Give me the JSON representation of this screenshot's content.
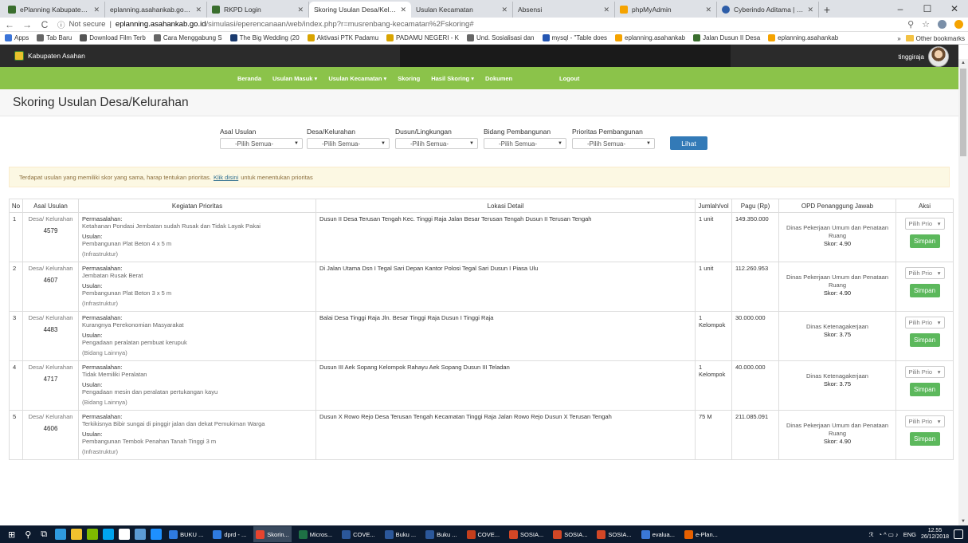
{
  "browser": {
    "tabs": [
      {
        "title": "ePlanning Kabupaten Asah",
        "icon": "app"
      },
      {
        "title": "eplanning.asahankab.go.id/",
        "icon": "page"
      },
      {
        "title": "RKPD Login",
        "icon": "app"
      },
      {
        "title": "Skoring Usulan Desa/Kelura",
        "icon": "page",
        "active": true
      },
      {
        "title": "Usulan Kecamatan",
        "icon": "page"
      },
      {
        "title": "Absensi",
        "icon": "page"
      },
      {
        "title": "phpMyAdmin",
        "icon": "pma"
      },
      {
        "title": "Cyberindo Aditama | Speed",
        "icon": "cyb"
      }
    ],
    "address": {
      "secure_label": "Not secure",
      "host": "eplanning.asahankab.go.id",
      "path": "/simulasi/eperencanaan/web/index.php?r=musrenbang-kecamatan%2Fskoring#"
    },
    "bookmarks": [
      "Apps",
      "Tab Baru",
      "Download Film Terb",
      "Cara Menggabung S",
      "The Big Wedding (20",
      "Aktivasi PTK Padamu",
      "PADAMU NEGERI - K",
      "Und. Sosialisasi dan",
      "mysql - \"Table does",
      "eplanning.asahankab",
      "Jalan Dusun II Desa",
      "eplanning.asahankab"
    ],
    "bookmarks_more": "»",
    "other_bookmarks": "Other bookmarks"
  },
  "app": {
    "brand": "Kabupaten Asahan",
    "user": "tinggiraja",
    "menu": [
      {
        "label": "Beranda",
        "dropdown": false
      },
      {
        "label": "Usulan Masuk",
        "dropdown": true
      },
      {
        "label": "Usulan Kecamatan",
        "dropdown": true
      },
      {
        "label": "Skoring",
        "dropdown": false
      },
      {
        "label": "Hasil Skoring",
        "dropdown": true
      },
      {
        "label": "Dokumen",
        "dropdown": false
      }
    ],
    "logout": "Logout",
    "page_title": "Skoring Usulan Desa/Kelurahan",
    "filters": [
      {
        "label": "Asal Usulan",
        "value": "-Pilih Semua-"
      },
      {
        "label": "Desa/Kelurahan",
        "value": "-Pilih Semua-"
      },
      {
        "label": "Dusun/Lingkungan",
        "value": "-Pilih Semua-"
      },
      {
        "label": "Bidang Pembangunan",
        "value": "-Pilih Semua-"
      },
      {
        "label": "Prioritas Pembangunan",
        "value": "-Pilih Semua-"
      }
    ],
    "lihat": "Lihat",
    "alert": {
      "before": "Terdapat usulan yang memiliki skor yang sama, harap tentukan prioritas.",
      "link": "Klik disini",
      "after": "untuk menentukan prioritas"
    },
    "table": {
      "headers": [
        "No",
        "Asal Usulan",
        "Kegiatan Prioritas",
        "Lokasi Detail",
        "Jumlah/vol",
        "Pagu (Rp)",
        "OPD Penanggung Jawab",
        "Aksi"
      ],
      "label_permasalahan": "Permasalahan:",
      "label_usulan": "Usulan:",
      "prio_placeholder": "Pilih Prio",
      "simpan": "Simpan",
      "rows": [
        {
          "no": "1",
          "asal": "Desa/ Kelurahan",
          "kode": "4579",
          "permasalahan": "Ketahanan Pondasi Jembatan sudah Rusak dan Tidak Layak Pakai",
          "usulan": "Pembangunan Plat Beton 4 x 5 m",
          "kategori": "(Infrastruktur)",
          "lokasi": "Dusun II Desa Terusan Tengah Kec. Tinggi Raja Jalan Besar Terusan Tengah Dusun II Terusan Tengah",
          "jumlah": "1 unit",
          "pagu": "149.350.000",
          "opd": "Dinas Pekerjaan Umum dan Penataan Ruang",
          "skor": "Skor: 4.90"
        },
        {
          "no": "2",
          "asal": "Desa/ Kelurahan",
          "kode": "4607",
          "permasalahan": "Jembatan Rusak Berat",
          "usulan": "Pembangunan Plat Beton 3 x 5 m",
          "kategori": "(Infrastruktur)",
          "lokasi": "Di Jalan Utama Dsn I Tegal Sari Depan Kantor Polosi Tegal Sari Dusun I Piasa Ulu",
          "jumlah": "1 unit",
          "pagu": "112.260.953",
          "opd": "Dinas Pekerjaan Umum dan Penataan Ruang",
          "skor": "Skor: 4.90"
        },
        {
          "no": "3",
          "asal": "Desa/ Kelurahan",
          "kode": "4483",
          "permasalahan": "Kurangnya Perekonomian Masyarakat",
          "usulan": "Pengadaan peralatan pembuat kerupuk",
          "kategori": "(Bidang Lainnya)",
          "lokasi": "Balai Desa Tinggi Raja Jln. Besar Tinggi Raja Dusun I Tinggi Raja",
          "jumlah": "1 Kelompok",
          "pagu": "30.000.000",
          "opd": "Dinas Ketenagakerjaan",
          "skor": "Skor: 3.75"
        },
        {
          "no": "4",
          "asal": "Desa/ Kelurahan",
          "kode": "4717",
          "permasalahan": "Tidak Memiliki Peralatan",
          "usulan": "Pengadaan mesin dan peralatan pertukangan kayu",
          "kategori": "(Bidang Lainnya)",
          "lokasi": "Dusun III Aek Sopang Kelompok Rahayu Aek Sopang Dusun III Teladan",
          "jumlah": "1 Kelompok",
          "pagu": "40.000.000",
          "opd": "Dinas Ketenagakerjaan",
          "skor": "Skor: 3.75"
        },
        {
          "no": "5",
          "asal": "Desa/ Kelurahan",
          "kode": "4606",
          "permasalahan": "Terkikisnya Bibir sungai di pinggir jalan dan dekat Pemukiman Warga",
          "usulan": "Pembangunan Tembok Penahan Tanah Tinggi 3 m",
          "kategori": "(Infrastruktur)",
          "lokasi": "Dusun X Rowo Rejo Desa Terusan Tengah Kecamatan Tinggi Raja Jalan Rowo Rejo Dusun X Terusan Tengah",
          "jumlah": "75 M",
          "pagu": "211.085.091",
          "opd": "Dinas Pekerjaan Umum dan Penataan Ruang",
          "skor": "Skor: 4.90"
        }
      ]
    }
  },
  "taskbar": {
    "items": [
      {
        "label": "BUKU ...",
        "color": "#2f7be0"
      },
      {
        "label": "dprd - ...",
        "color": "#2f7be0"
      },
      {
        "label": "Skorin...",
        "color": "#e8442e",
        "active": true
      },
      {
        "label": "Micros...",
        "color": "#1e7145"
      },
      {
        "label": "COVE...",
        "color": "#2b579a"
      },
      {
        "label": "Buku ...",
        "color": "#2b579a"
      },
      {
        "label": "Buku ...",
        "color": "#2b579a"
      },
      {
        "label": "COVE...",
        "color": "#c43e1c"
      },
      {
        "label": "SOSIA...",
        "color": "#d24726"
      },
      {
        "label": "SOSIA...",
        "color": "#d24726"
      },
      {
        "label": "SOSIA...",
        "color": "#d24726"
      },
      {
        "label": "evalua...",
        "color": "#3a78d6"
      },
      {
        "label": "e-Plan...",
        "color": "#e66000"
      }
    ],
    "lang": "ENG",
    "time": "12.55",
    "date": "26/12/2018"
  }
}
